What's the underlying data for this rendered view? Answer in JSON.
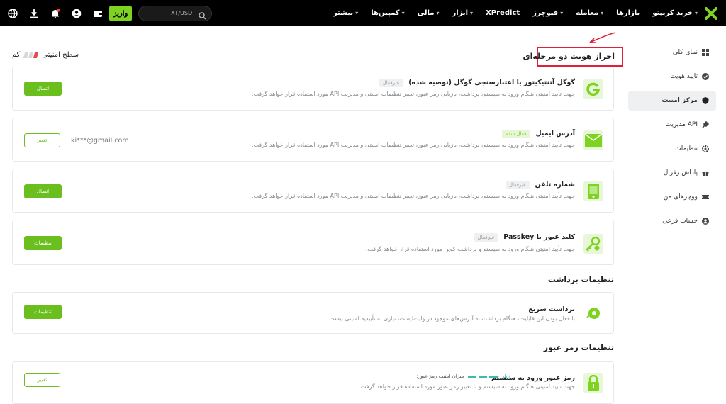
{
  "topbar": {
    "nav": [
      {
        "label": "خرید کریپتو",
        "has_menu": true
      },
      {
        "label": "بازارها",
        "has_menu": false
      },
      {
        "label": "معامله",
        "has_menu": true
      },
      {
        "label": "فیوچرز",
        "has_menu": true
      },
      {
        "label": "XPredict",
        "has_menu": false
      },
      {
        "label": "ابزار",
        "has_menu": true
      },
      {
        "label": "مالی",
        "has_menu": true
      },
      {
        "label": "کمپین‌ها",
        "has_menu": true
      },
      {
        "label": "بیشتر",
        "has_menu": true
      }
    ],
    "search_text": "XT/USDT",
    "deposit_label": "واریز",
    "icons": [
      "search-icon",
      "wallet-icon",
      "user-icon",
      "notification-bell-icon",
      "download-icon",
      "globe-icon"
    ]
  },
  "sidebar": {
    "items": [
      {
        "label": "نمای کلی",
        "icon": "overview-icon",
        "active": false
      },
      {
        "label": "تایید هویت",
        "icon": "verification-icon",
        "active": false
      },
      {
        "label": "مرکز امنیت",
        "icon": "shield-icon",
        "active": true
      },
      {
        "label": "مدیریت API",
        "icon": "api-icon",
        "active": false
      },
      {
        "label": "تنظیمات",
        "icon": "settings-icon",
        "active": false
      },
      {
        "label": "پاداش رفرال",
        "icon": "gift-icon",
        "active": false
      },
      {
        "label": "ووچرهای من",
        "icon": "voucher-icon",
        "active": false
      },
      {
        "label": "حساب فرعی",
        "icon": "subaccount-icon",
        "active": false
      }
    ]
  },
  "security_level": {
    "label": "سطح امنیتی",
    "value": "کم",
    "bars_filled": 1,
    "bars_total": 3
  },
  "sections": {
    "two_factor": "احراز هویت دو مرحله‌ای",
    "withdraw": "تنظیمات برداشت",
    "password": "تنظیمات رمز عبور"
  },
  "cards": [
    {
      "title": "گوگل آتنتیکیتور یا اعتبارسنجی گوگل  (توصیه شده)",
      "badge": "غیرفعال",
      "desc": "جهت تأیید امنیتی هنگام ورود به سیستم، برداشت، بازیابی رمز عبور، تغییر تنظیمات امنیتی و مدیریت API مورد استفاده قرار خواهد گرفت.",
      "button": "اتصال"
    },
    {
      "title": "آدرس ایمیل",
      "badge": "فعال شده",
      "desc": "جهت تأیید امنیتی هنگام ورود به سیستم، برداشت، بازیابی رمز عبور، تغییر تنظیمات امنیتی و مدیریت API مورد استفاده قرار خواهد گرفت.",
      "value": "ki***@gmail.com",
      "button": "تغییر"
    },
    {
      "title": "شماره تلفن",
      "badge": "غیرفعال",
      "desc": "جهت تأیید امنیتی هنگام ورود به سیستم، برداشت، بازیابی رمز عبور، تغییر تنظیمات امنیتی و مدیریت API مورد استفاده قرار خواهد گرفت.",
      "button": "اتصال"
    },
    {
      "title": "کلید عبور یا Passkey",
      "badge": "غیرفعال",
      "desc": "جهت تأیید امنیتی هنگام ورود به سیستم و برداشت کوین مورد استفاده قرار خواهد گرفت.",
      "button": "تنظیمات"
    },
    {
      "title": "برداشت سریع",
      "desc": "با فعال بودن این قابلیت، هنگام برداشت به آدرس‌های موجود در وایت‌لیست، نیازی به تأییدیه امنیتی نیست.",
      "button": "تنظیمات"
    },
    {
      "title": "رمز عبور ورود به سیستم",
      "desc": "جهت تأیید امنیتی هنگام ورود به سیستم و با تغییر رمز عبور مورد استفاده قرار خواهد گرفت.",
      "strength_label": "میزان امنیت رمز عبور:",
      "strength_value": "زیاد",
      "button": "تغییر"
    }
  ],
  "colors": {
    "accent": "#6abf1f",
    "highlight": "#e0203a",
    "teal": "#3cb9b0"
  }
}
